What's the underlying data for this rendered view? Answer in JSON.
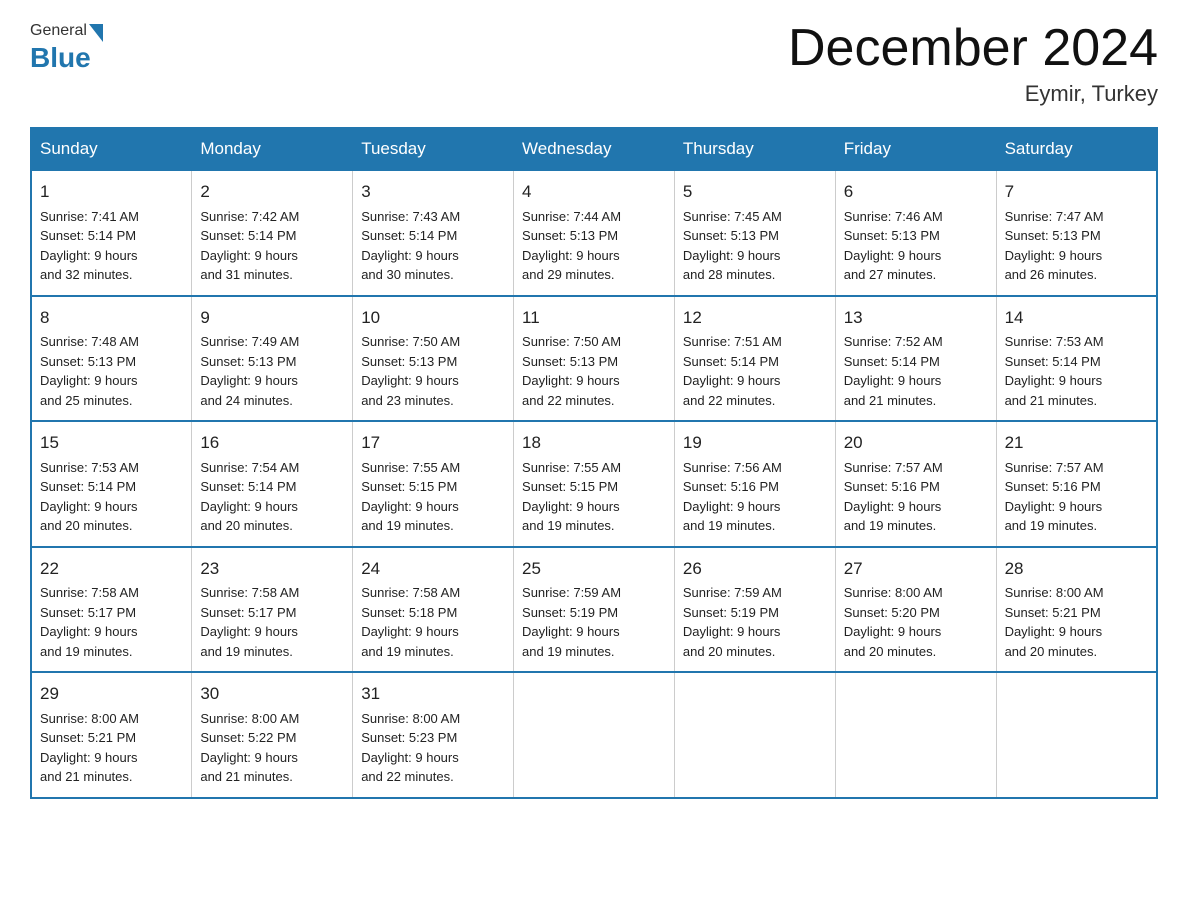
{
  "header": {
    "logo_general": "General",
    "logo_blue": "Blue",
    "month_year": "December 2024",
    "location": "Eymir, Turkey"
  },
  "days_of_week": [
    "Sunday",
    "Monday",
    "Tuesday",
    "Wednesday",
    "Thursday",
    "Friday",
    "Saturday"
  ],
  "weeks": [
    [
      {
        "day": "1",
        "sunrise": "7:41 AM",
        "sunset": "5:14 PM",
        "daylight": "9 hours and 32 minutes."
      },
      {
        "day": "2",
        "sunrise": "7:42 AM",
        "sunset": "5:14 PM",
        "daylight": "9 hours and 31 minutes."
      },
      {
        "day": "3",
        "sunrise": "7:43 AM",
        "sunset": "5:14 PM",
        "daylight": "9 hours and 30 minutes."
      },
      {
        "day": "4",
        "sunrise": "7:44 AM",
        "sunset": "5:13 PM",
        "daylight": "9 hours and 29 minutes."
      },
      {
        "day": "5",
        "sunrise": "7:45 AM",
        "sunset": "5:13 PM",
        "daylight": "9 hours and 28 minutes."
      },
      {
        "day": "6",
        "sunrise": "7:46 AM",
        "sunset": "5:13 PM",
        "daylight": "9 hours and 27 minutes."
      },
      {
        "day": "7",
        "sunrise": "7:47 AM",
        "sunset": "5:13 PM",
        "daylight": "9 hours and 26 minutes."
      }
    ],
    [
      {
        "day": "8",
        "sunrise": "7:48 AM",
        "sunset": "5:13 PM",
        "daylight": "9 hours and 25 minutes."
      },
      {
        "day": "9",
        "sunrise": "7:49 AM",
        "sunset": "5:13 PM",
        "daylight": "9 hours and 24 minutes."
      },
      {
        "day": "10",
        "sunrise": "7:50 AM",
        "sunset": "5:13 PM",
        "daylight": "9 hours and 23 minutes."
      },
      {
        "day": "11",
        "sunrise": "7:50 AM",
        "sunset": "5:13 PM",
        "daylight": "9 hours and 22 minutes."
      },
      {
        "day": "12",
        "sunrise": "7:51 AM",
        "sunset": "5:14 PM",
        "daylight": "9 hours and 22 minutes."
      },
      {
        "day": "13",
        "sunrise": "7:52 AM",
        "sunset": "5:14 PM",
        "daylight": "9 hours and 21 minutes."
      },
      {
        "day": "14",
        "sunrise": "7:53 AM",
        "sunset": "5:14 PM",
        "daylight": "9 hours and 21 minutes."
      }
    ],
    [
      {
        "day": "15",
        "sunrise": "7:53 AM",
        "sunset": "5:14 PM",
        "daylight": "9 hours and 20 minutes."
      },
      {
        "day": "16",
        "sunrise": "7:54 AM",
        "sunset": "5:14 PM",
        "daylight": "9 hours and 20 minutes."
      },
      {
        "day": "17",
        "sunrise": "7:55 AM",
        "sunset": "5:15 PM",
        "daylight": "9 hours and 19 minutes."
      },
      {
        "day": "18",
        "sunrise": "7:55 AM",
        "sunset": "5:15 PM",
        "daylight": "9 hours and 19 minutes."
      },
      {
        "day": "19",
        "sunrise": "7:56 AM",
        "sunset": "5:16 PM",
        "daylight": "9 hours and 19 minutes."
      },
      {
        "day": "20",
        "sunrise": "7:57 AM",
        "sunset": "5:16 PM",
        "daylight": "9 hours and 19 minutes."
      },
      {
        "day": "21",
        "sunrise": "7:57 AM",
        "sunset": "5:16 PM",
        "daylight": "9 hours and 19 minutes."
      }
    ],
    [
      {
        "day": "22",
        "sunrise": "7:58 AM",
        "sunset": "5:17 PM",
        "daylight": "9 hours and 19 minutes."
      },
      {
        "day": "23",
        "sunrise": "7:58 AM",
        "sunset": "5:17 PM",
        "daylight": "9 hours and 19 minutes."
      },
      {
        "day": "24",
        "sunrise": "7:58 AM",
        "sunset": "5:18 PM",
        "daylight": "9 hours and 19 minutes."
      },
      {
        "day": "25",
        "sunrise": "7:59 AM",
        "sunset": "5:19 PM",
        "daylight": "9 hours and 19 minutes."
      },
      {
        "day": "26",
        "sunrise": "7:59 AM",
        "sunset": "5:19 PM",
        "daylight": "9 hours and 20 minutes."
      },
      {
        "day": "27",
        "sunrise": "8:00 AM",
        "sunset": "5:20 PM",
        "daylight": "9 hours and 20 minutes."
      },
      {
        "day": "28",
        "sunrise": "8:00 AM",
        "sunset": "5:21 PM",
        "daylight": "9 hours and 20 minutes."
      }
    ],
    [
      {
        "day": "29",
        "sunrise": "8:00 AM",
        "sunset": "5:21 PM",
        "daylight": "9 hours and 21 minutes."
      },
      {
        "day": "30",
        "sunrise": "8:00 AM",
        "sunset": "5:22 PM",
        "daylight": "9 hours and 21 minutes."
      },
      {
        "day": "31",
        "sunrise": "8:00 AM",
        "sunset": "5:23 PM",
        "daylight": "9 hours and 22 minutes."
      },
      null,
      null,
      null,
      null
    ]
  ],
  "labels": {
    "sunrise": "Sunrise:",
    "sunset": "Sunset:",
    "daylight": "Daylight:"
  }
}
